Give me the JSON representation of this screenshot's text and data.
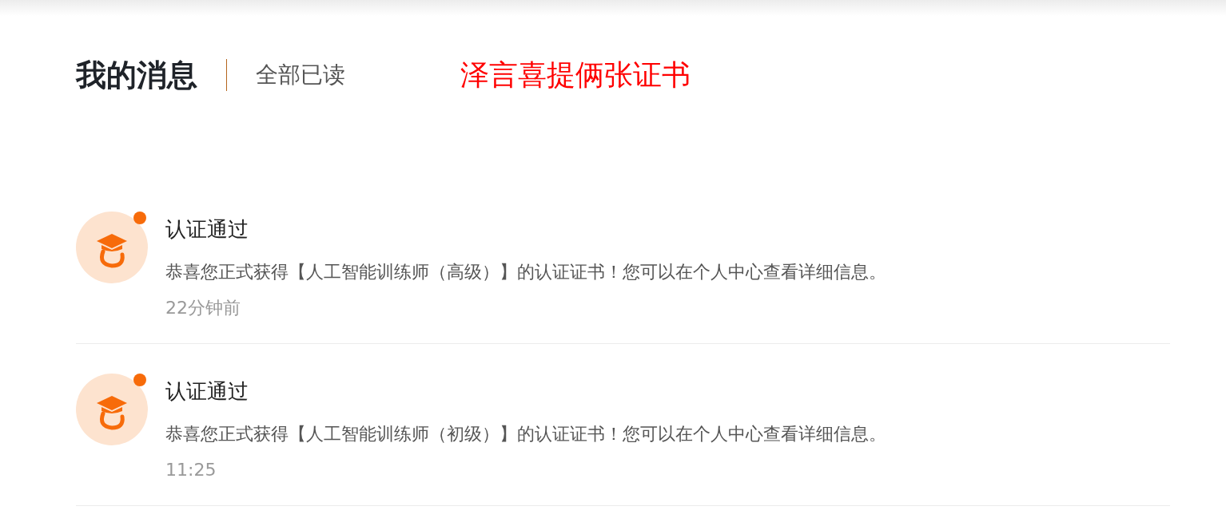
{
  "header": {
    "title": "我的消息",
    "mark_all_read": "全部已读",
    "annotation": "泽言喜提俩张证书"
  },
  "messages": [
    {
      "title": "认证通过",
      "body": "恭喜您正式获得【人工智能训练师（高级）】的认证证书！您可以在个人中心查看详细信息。",
      "time": "22分钟前",
      "unread": true
    },
    {
      "title": "认证通过",
      "body": "恭喜您正式获得【人工智能训练师（初级）】的认证证书！您可以在个人中心查看详细信息。",
      "time": "11:25",
      "unread": true
    }
  ]
}
